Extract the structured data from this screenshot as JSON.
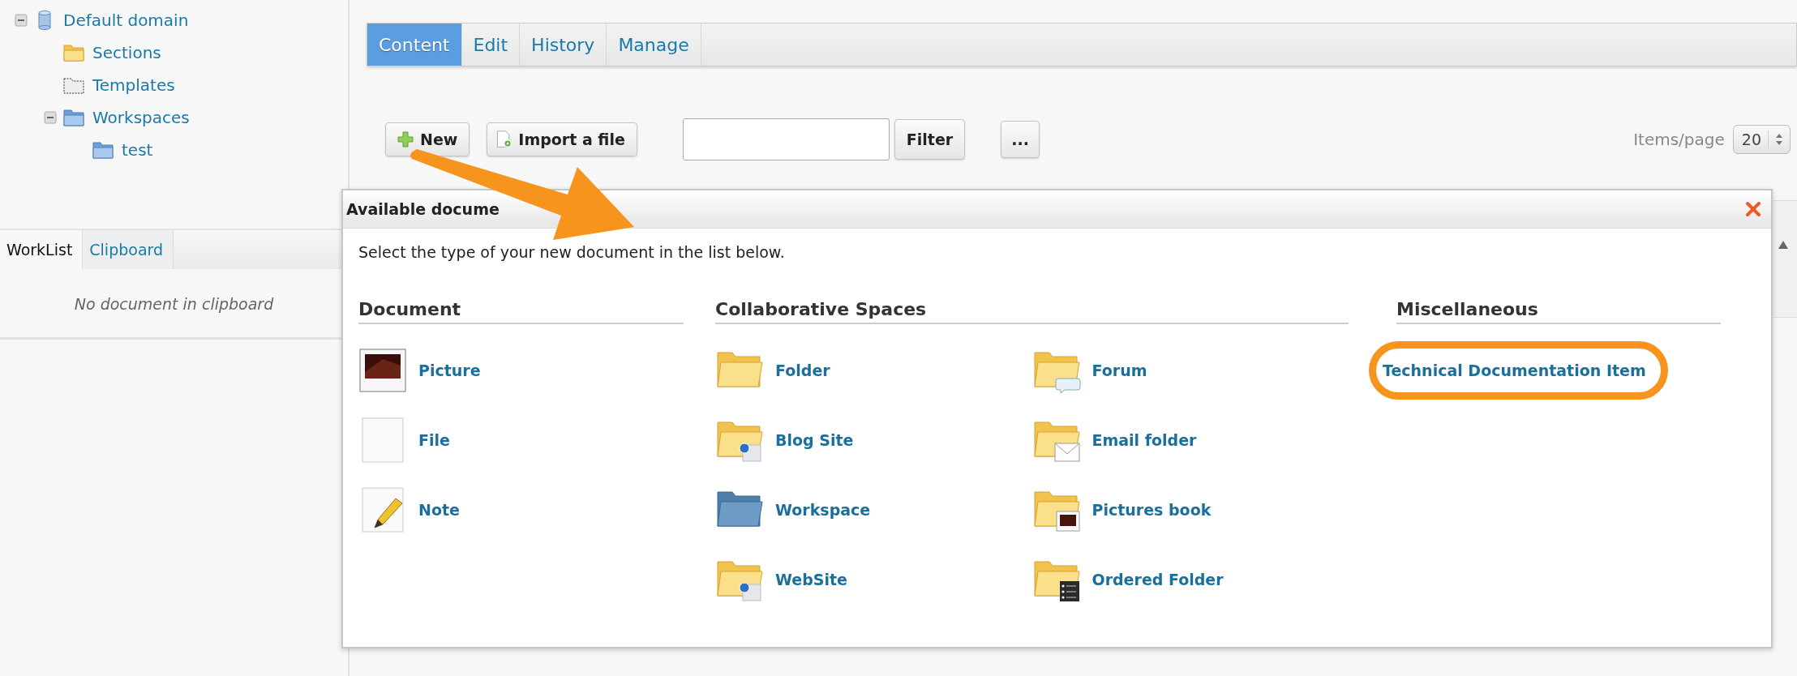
{
  "tree": {
    "label": "Default domain",
    "kind": "domain",
    "expanded": true,
    "children": [
      {
        "label": "Sections",
        "kind": "sections"
      },
      {
        "label": "Templates",
        "kind": "templates"
      },
      {
        "label": "Workspaces",
        "kind": "workspaces",
        "expanded": true,
        "children": [
          {
            "label": "test",
            "kind": "folder"
          }
        ]
      }
    ]
  },
  "side_tabs": [
    {
      "label": "WorkList",
      "selected": true
    },
    {
      "label": "Clipboard",
      "selected": false
    }
  ],
  "side_message": "No document in clipboard",
  "tabs": [
    {
      "label": "Content",
      "selected": true
    },
    {
      "label": "Edit",
      "selected": false
    },
    {
      "label": "History",
      "selected": false
    },
    {
      "label": "Manage",
      "selected": false
    }
  ],
  "toolbar": {
    "new_button": "New",
    "import_button": "Import a file",
    "filter_button": "Filter",
    "more_button": "...",
    "items_per_page_label": "Items/page",
    "items_per_page": "20"
  },
  "dialog": {
    "title": "Available docume",
    "instruction": "Select the type of your new document in the list below.",
    "groups": [
      {
        "heading": "Document",
        "columns": [
          [
            {
              "label": "Picture",
              "kind": "picture"
            },
            {
              "label": "File",
              "kind": "file"
            },
            {
              "label": "Note",
              "kind": "note"
            }
          ]
        ]
      },
      {
        "heading": "Collaborative Spaces",
        "columns": [
          [
            {
              "label": "Folder",
              "kind": "folder"
            },
            {
              "label": "Blog Site",
              "kind": "blog"
            },
            {
              "label": "Workspace",
              "kind": "workspace"
            },
            {
              "label": "WebSite",
              "kind": "website"
            }
          ],
          [
            {
              "label": "Forum",
              "kind": "forum"
            },
            {
              "label": "Email folder",
              "kind": "email"
            },
            {
              "label": "Pictures book",
              "kind": "picturesbook"
            },
            {
              "label": "Ordered Folder",
              "kind": "ordered"
            }
          ]
        ]
      },
      {
        "heading": "Miscellaneous",
        "columns": [
          [
            {
              "label": "Technical Documentation Item",
              "kind": "none",
              "highlighted": true
            }
          ]
        ]
      }
    ]
  }
}
